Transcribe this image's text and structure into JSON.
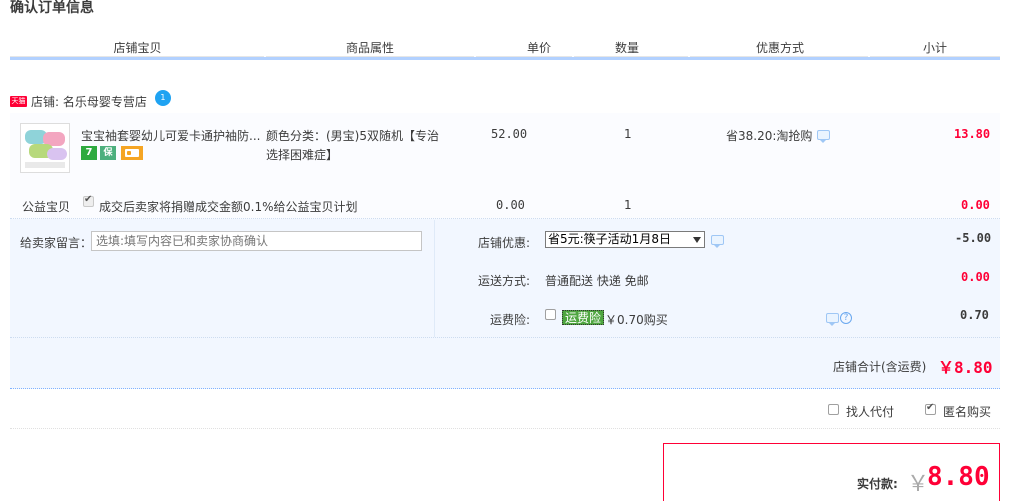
{
  "page": {
    "title": "确认订单信息"
  },
  "columns": [
    "店铺宝贝",
    "商品属性",
    "单价",
    "数量",
    "优惠方式",
    "小计"
  ],
  "shop": {
    "badge": "天猫",
    "label": "店铺: 名乐母婴专营店",
    "wangwang_count": "1"
  },
  "item": {
    "title": "宝宝袖套婴幼儿可爱卡通护袖防...",
    "badges": [
      {
        "text": "7",
        "color": "#2faa3f",
        "icon": "seven-day-return-icon"
      },
      {
        "text": "保",
        "color": "#4caf7d",
        "icon": "guarantee-icon"
      },
      {
        "text": "",
        "color": "#f5a524",
        "icon": "card-payment-icon"
      }
    ],
    "attr_line1": "颜色分类：(男宝)5双随机【专治",
    "attr_line2": "选择困难症】",
    "price": "52.00",
    "qty": "1",
    "discount": "省38.20:淘抢购",
    "subtotal": "13.80"
  },
  "charity": {
    "label": "公益宝贝",
    "text": "成交后卖家将捐赠成交金额0.1%给公益宝贝计划",
    "price": "0.00",
    "qty": "1",
    "subtotal": "0.00"
  },
  "message": {
    "label": "给卖家留言：",
    "placeholder": "选填:填写内容已和卖家协商确认"
  },
  "shop_discount": {
    "label": "店铺优惠:",
    "selected": "省5元:筷子活动1月8日",
    "amount": "-5.00"
  },
  "shipping": {
    "label": "运送方式:",
    "value": "普通配送 快递 免邮",
    "amount": "0.00"
  },
  "insurance": {
    "label": "运费险:",
    "tag": "运费险",
    "price": "￥0.70购买",
    "amount": "0.70"
  },
  "shop_total": {
    "label": "店铺合计(含运费)",
    "amount": "￥8.80"
  },
  "options": {
    "proxy_label": "找人代付",
    "anonymous_label": "匿名购买"
  },
  "pay": {
    "label": "实付款:",
    "currency": "￥",
    "amount": "8.80"
  },
  "colors": {
    "accent_red": "#ff0036",
    "header_line": "#b2d1ff",
    "panel_bg": "#f2f7ff"
  }
}
